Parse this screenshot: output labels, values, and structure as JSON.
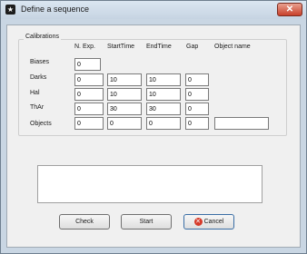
{
  "window": {
    "title": "Define a sequence"
  },
  "calibrations": {
    "group_label": "Calibrations",
    "headers": {
      "nexp": "N. Exp.",
      "starttime": "StartTime",
      "endtime": "EndTime",
      "gap": "Gap",
      "objname": "Object name"
    },
    "rows": [
      {
        "label": "Biases",
        "nexp": "0"
      },
      {
        "label": "Darks",
        "nexp": "0",
        "starttime": "10",
        "endtime": "10",
        "gap": "0"
      },
      {
        "label": "Hal",
        "nexp": "0",
        "starttime": "10",
        "endtime": "10",
        "gap": "0"
      },
      {
        "label": "ThAr",
        "nexp": "0",
        "starttime": "30",
        "endtime": "30",
        "gap": "0"
      },
      {
        "label": "Objects",
        "nexp": "0",
        "starttime": "0",
        "endtime": "0",
        "gap": "0",
        "objname": ""
      }
    ]
  },
  "buttons": {
    "check": "Check",
    "start": "Start",
    "cancel": "Cancel"
  },
  "icons": {
    "app": "app-icon",
    "close": "close-icon",
    "cancel": "cancel-icon"
  }
}
